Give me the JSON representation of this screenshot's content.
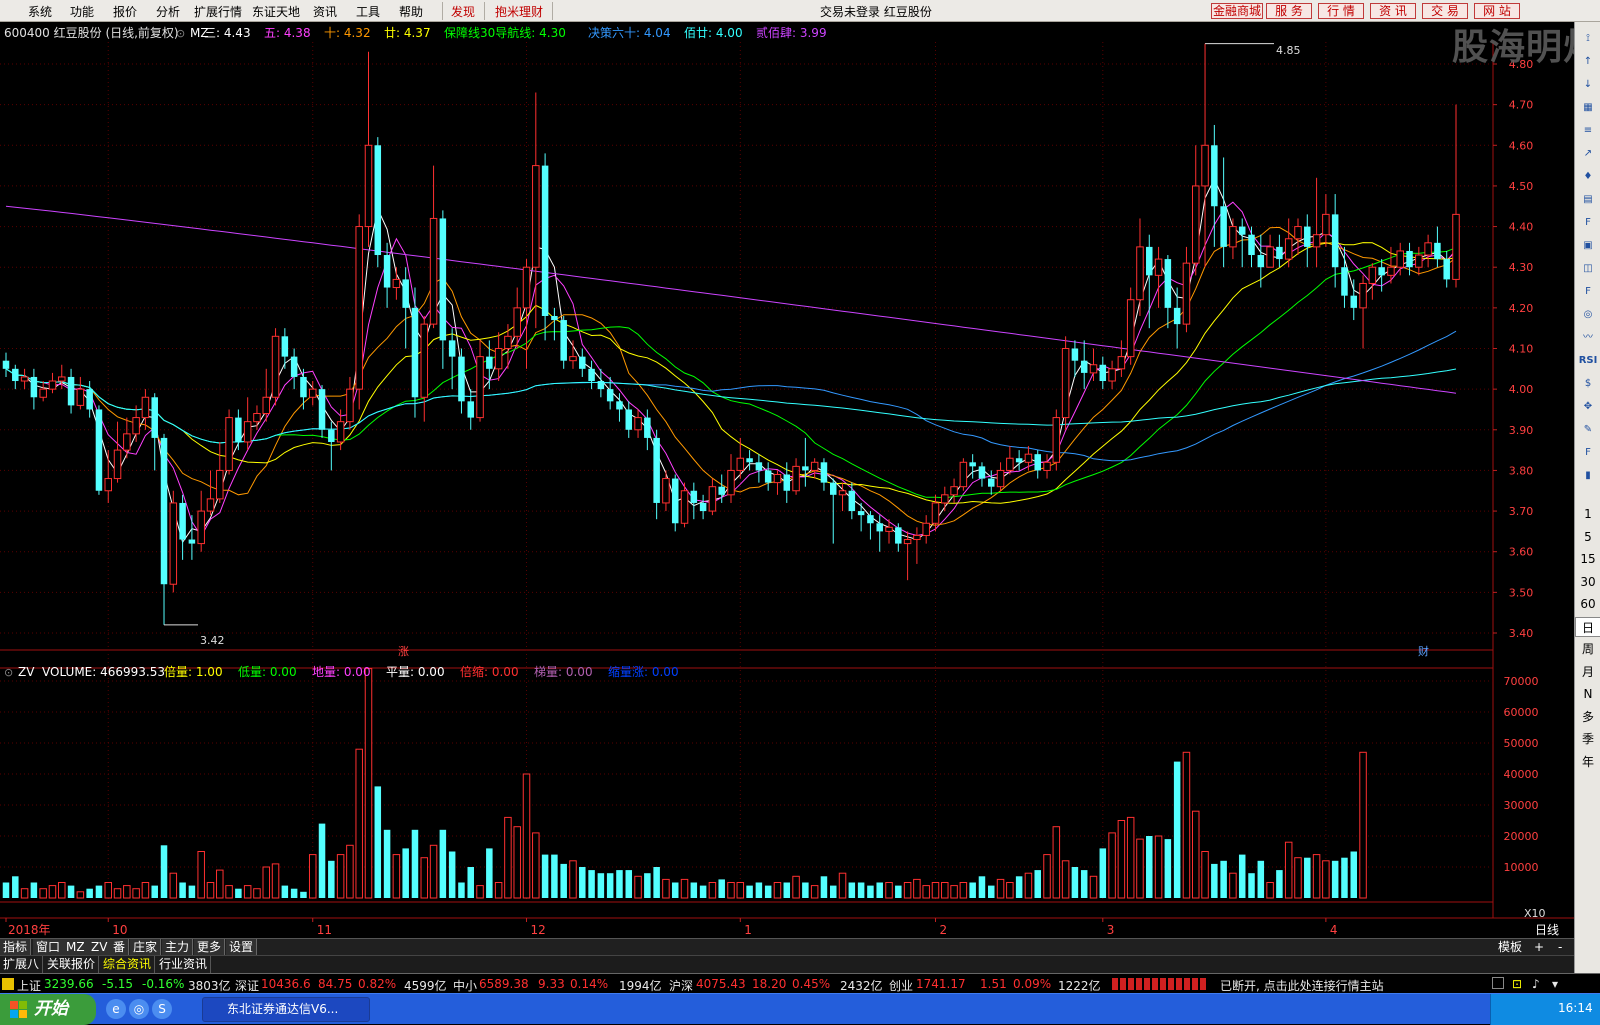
{
  "menu": {
    "items": [
      "系统",
      "功能",
      "报价",
      "分析",
      "扩展行情",
      "东证天地",
      "资讯",
      "工具",
      "帮助"
    ],
    "hot_items": [
      "发现",
      "抱米理财"
    ],
    "status": "交易未登录  红豆股份",
    "buttons": [
      "金融商城",
      "服  务",
      "行  情",
      "资  讯",
      "交  易",
      "网  站"
    ]
  },
  "watermark": "股海明灯",
  "header": {
    "code_name": "600400 红豆股份 (日线,前复权)",
    "indicator": "MZ",
    "items": [
      {
        "label": "三:",
        "value": "4.43",
        "color": "#ffffff"
      },
      {
        "label": "五:",
        "value": "4.38",
        "color": "#ff40ff"
      },
      {
        "label": "十:",
        "value": "4.32",
        "color": "#ff9900"
      },
      {
        "label": "廿:",
        "value": "4.37",
        "color": "#ffff00"
      },
      {
        "label": "保障线30导航线:",
        "value": "4.30",
        "color": "#00ff00"
      },
      {
        "label": "决策六十:",
        "value": "4.04",
        "color": "#3399ff"
      },
      {
        "label": "佰廿:",
        "value": "4.00",
        "color": "#33ffff"
      },
      {
        "label": "贰佰肆:",
        "value": "3.99",
        "color": "#cc44ff"
      }
    ]
  },
  "price_axis": {
    "ticks": [
      "4.80",
      "4.70",
      "4.60",
      "4.50",
      "4.40",
      "4.30",
      "4.20",
      "4.10",
      "4.00",
      "3.90",
      "3.80",
      "3.70",
      "3.60",
      "3.50",
      "3.40"
    ]
  },
  "annotations": {
    "high": "4.85",
    "low": "3.42",
    "zhang": "涨",
    "cai": "财",
    "x10": "X10"
  },
  "volume_header": {
    "indicator": "ZV",
    "items": [
      {
        "label": "VOLUME:",
        "value": "466993.53",
        "color": "#ffffff"
      },
      {
        "label": "倍量:",
        "value": "1.00",
        "color": "#ffff00"
      },
      {
        "label": "低量:",
        "value": "0.00",
        "color": "#00ff00"
      },
      {
        "label": "地量:",
        "value": "0.00",
        "color": "#ff40ff"
      },
      {
        "label": "平量:",
        "value": "0.00",
        "color": "#ffffff"
      },
      {
        "label": "倍缩:",
        "value": "0.00",
        "color": "#ff3030"
      },
      {
        "label": "梯量:",
        "value": "0.00",
        "color": "#b060b0"
      },
      {
        "label": "缩量涨:",
        "value": "0.00",
        "color": "#0040ff"
      }
    ]
  },
  "volume_axis": {
    "ticks": [
      "70000",
      "60000",
      "50000",
      "40000",
      "30000",
      "20000",
      "10000"
    ]
  },
  "date_axis": [
    "2018年",
    "10",
    "11",
    "12",
    "1",
    "2",
    "3",
    "4"
  ],
  "date_label": "日线",
  "right_tools": {
    "icons": [
      "pin-icon",
      "up-arrow-icon",
      "down-arrow-icon",
      "grid-icon",
      "list-icon",
      "chart-icon",
      "kline-icon",
      "table-icon",
      "f10-icon",
      "report-icon",
      "news-icon",
      "f2-icon",
      "compass-icon",
      "sig-icon",
      "rsi-icon",
      "dollar-icon",
      "move-icon",
      "pen-icon",
      "f5-icon",
      "bars-icon"
    ],
    "rsi": "RSI",
    "periods": [
      "1",
      "5",
      "15",
      "30",
      "60",
      "日",
      "周",
      "月",
      "N",
      "多",
      "季",
      "年"
    ]
  },
  "tabs1": {
    "items": [
      "指标",
      "窗口",
      "MZ",
      "ZV",
      "番",
      "庄家",
      "主力",
      "更多",
      "设置"
    ],
    "right": [
      "模板",
      "+",
      "-"
    ]
  },
  "tabs2": {
    "items": [
      "扩展八",
      "关联报价",
      "综合资讯",
      "行业资讯"
    ],
    "active": "综合资讯"
  },
  "ticker": {
    "sh": {
      "name": "上证",
      "price": "3239.66",
      "chg": "-5.15",
      "pct": "-0.16%",
      "amt": "3803亿"
    },
    "sz": {
      "name": "深证",
      "price": "10436.6",
      "chg": "84.75",
      "pct": "0.82%",
      "amt": "4599亿"
    },
    "zx": {
      "name": "中小",
      "price": "6589.38",
      "chg": "9.33",
      "pct": "0.14%",
      "amt": "1994亿"
    },
    "hs": {
      "name": "沪深",
      "price": "4075.43",
      "chg": "18.20",
      "pct": "0.45%",
      "amt": "2432亿"
    },
    "cy": {
      "name": "创业",
      "price": "1741.17",
      "chg": "1.51",
      "pct": "0.09%",
      "amt": "1222亿"
    },
    "msg": "已断开, 点击此处连接行情主站"
  },
  "taskbar": {
    "start": "开始",
    "app": "东北证券通达信V6...",
    "clock": "16:14"
  },
  "chart_data": {
    "type": "candlestick",
    "y_range": [
      3.4,
      4.85
    ],
    "high_marker": 4.85,
    "low_marker": 3.42,
    "ohlc": [
      [
        4.07,
        4.05,
        4.03,
        4.09
      ],
      [
        4.05,
        4.02,
        4.0,
        4.06
      ],
      [
        4.02,
        4.03,
        4.0,
        4.05
      ],
      [
        4.03,
        3.98,
        3.95,
        4.05
      ],
      [
        3.98,
        4.0,
        3.97,
        4.02
      ],
      [
        4.0,
        4.02,
        3.99,
        4.04
      ],
      [
        4.02,
        4.03,
        4.0,
        4.06
      ],
      [
        4.03,
        3.96,
        3.94,
        4.05
      ],
      [
        3.96,
        4.0,
        3.95,
        4.03
      ],
      [
        4.0,
        3.95,
        3.93,
        4.02
      ],
      [
        3.95,
        3.75,
        3.74,
        3.96
      ],
      [
        3.75,
        3.78,
        3.72,
        3.85
      ],
      [
        3.78,
        3.85,
        3.77,
        3.92
      ],
      [
        3.85,
        3.89,
        3.83,
        3.93
      ],
      [
        3.89,
        3.93,
        3.87,
        3.96
      ],
      [
        3.93,
        3.98,
        3.9,
        4.0
      ],
      [
        3.98,
        3.88,
        3.8,
        3.99
      ],
      [
        3.88,
        3.52,
        3.42,
        3.89
      ],
      [
        3.52,
        3.72,
        3.5,
        3.75
      ],
      [
        3.72,
        3.63,
        3.58,
        3.74
      ],
      [
        3.63,
        3.62,
        3.58,
        3.69
      ],
      [
        3.62,
        3.7,
        3.6,
        3.75
      ],
      [
        3.7,
        3.73,
        3.69,
        3.8
      ],
      [
        3.73,
        3.8,
        3.72,
        3.87
      ],
      [
        3.8,
        3.93,
        3.79,
        3.95
      ],
      [
        3.93,
        3.87,
        3.85,
        3.95
      ],
      [
        3.87,
        3.92,
        3.85,
        3.98
      ],
      [
        3.92,
        3.94,
        3.9,
        3.96
      ],
      [
        3.94,
        3.98,
        3.92,
        4.05
      ],
      [
        3.98,
        4.13,
        3.96,
        4.15
      ],
      [
        4.13,
        4.08,
        4.05,
        4.15
      ],
      [
        4.08,
        4.03,
        4.0,
        4.1
      ],
      [
        4.03,
        3.98,
        3.95,
        4.05
      ],
      [
        3.98,
        4.0,
        3.96,
        4.02
      ],
      [
        4.0,
        3.9,
        3.88,
        4.01
      ],
      [
        3.9,
        3.87,
        3.8,
        3.92
      ],
      [
        3.87,
        3.92,
        3.85,
        3.95
      ],
      [
        3.92,
        4.0,
        3.9,
        4.03
      ],
      [
        4.0,
        4.4,
        3.95,
        4.43
      ],
      [
        4.4,
        4.6,
        4.35,
        4.83
      ],
      [
        4.6,
        4.33,
        4.3,
        4.62
      ],
      [
        4.33,
        4.25,
        4.2,
        4.36
      ],
      [
        4.25,
        4.27,
        4.22,
        4.3
      ],
      [
        4.27,
        4.2,
        4.1,
        4.3
      ],
      [
        4.2,
        3.98,
        3.93,
        4.25
      ],
      [
        3.98,
        4.16,
        3.92,
        4.18
      ],
      [
        4.16,
        4.42,
        4.15,
        4.55
      ],
      [
        4.42,
        4.12,
        4.05,
        4.44
      ],
      [
        4.12,
        4.08,
        4.0,
        4.15
      ],
      [
        4.08,
        3.97,
        3.94,
        4.1
      ],
      [
        3.97,
        3.93,
        3.9,
        4.0
      ],
      [
        3.93,
        4.08,
        3.92,
        4.12
      ],
      [
        4.08,
        4.05,
        4.0,
        4.12
      ],
      [
        4.05,
        4.1,
        4.02,
        4.14
      ],
      [
        4.1,
        4.13,
        4.05,
        4.16
      ],
      [
        4.13,
        4.2,
        4.1,
        4.25
      ],
      [
        4.2,
        4.3,
        4.05,
        4.32
      ],
      [
        4.3,
        4.55,
        4.15,
        4.73
      ],
      [
        4.55,
        4.18,
        4.12,
        4.58
      ],
      [
        4.18,
        4.17,
        4.12,
        4.2
      ],
      [
        4.17,
        4.07,
        4.05,
        4.18
      ],
      [
        4.07,
        4.08,
        4.05,
        4.12
      ],
      [
        4.08,
        4.05,
        4.03,
        4.1
      ],
      [
        4.05,
        4.02,
        4.0,
        4.07
      ],
      [
        4.02,
        4.0,
        3.98,
        4.05
      ],
      [
        4.0,
        3.97,
        3.95,
        4.03
      ],
      [
        3.97,
        3.95,
        3.92,
        3.99
      ],
      [
        3.95,
        3.9,
        3.88,
        3.97
      ],
      [
        3.9,
        3.93,
        3.88,
        3.95
      ],
      [
        3.93,
        3.88,
        3.85,
        3.95
      ],
      [
        3.88,
        3.72,
        3.68,
        3.9
      ],
      [
        3.72,
        3.78,
        3.7,
        3.8
      ],
      [
        3.78,
        3.67,
        3.65,
        3.79
      ],
      [
        3.67,
        3.75,
        3.66,
        3.77
      ],
      [
        3.75,
        3.72,
        3.68,
        3.77
      ],
      [
        3.72,
        3.7,
        3.68,
        3.74
      ],
      [
        3.7,
        3.76,
        3.69,
        3.78
      ],
      [
        3.76,
        3.74,
        3.72,
        3.79
      ],
      [
        3.74,
        3.8,
        3.72,
        3.84
      ],
      [
        3.8,
        3.83,
        3.78,
        3.88
      ],
      [
        3.83,
        3.82,
        3.8,
        3.85
      ],
      [
        3.82,
        3.8,
        3.77,
        3.84
      ],
      [
        3.8,
        3.77,
        3.75,
        3.82
      ],
      [
        3.77,
        3.79,
        3.74,
        3.8
      ],
      [
        3.79,
        3.75,
        3.72,
        3.82
      ],
      [
        3.75,
        3.81,
        3.74,
        3.83
      ],
      [
        3.81,
        3.8,
        3.76,
        3.88
      ],
      [
        3.8,
        3.82,
        3.78,
        3.83
      ],
      [
        3.82,
        3.77,
        3.75,
        3.83
      ],
      [
        3.77,
        3.74,
        3.62,
        3.78
      ],
      [
        3.74,
        3.75,
        3.7,
        3.77
      ],
      [
        3.75,
        3.7,
        3.68,
        3.77
      ],
      [
        3.7,
        3.69,
        3.65,
        3.72
      ],
      [
        3.69,
        3.67,
        3.63,
        3.7
      ],
      [
        3.67,
        3.65,
        3.6,
        3.69
      ],
      [
        3.65,
        3.66,
        3.62,
        3.68
      ],
      [
        3.66,
        3.62,
        3.6,
        3.67
      ],
      [
        3.62,
        3.63,
        3.53,
        3.65
      ],
      [
        3.63,
        3.64,
        3.57,
        3.66
      ],
      [
        3.64,
        3.67,
        3.62,
        3.69
      ],
      [
        3.67,
        3.72,
        3.65,
        3.74
      ],
      [
        3.72,
        3.74,
        3.7,
        3.76
      ],
      [
        3.74,
        3.76,
        3.72,
        3.78
      ],
      [
        3.76,
        3.82,
        3.75,
        3.83
      ],
      [
        3.82,
        3.81,
        3.78,
        3.84
      ],
      [
        3.81,
        3.78,
        3.76,
        3.82
      ],
      [
        3.78,
        3.76,
        3.74,
        3.8
      ],
      [
        3.76,
        3.8,
        3.75,
        3.82
      ],
      [
        3.8,
        3.83,
        3.79,
        3.86
      ],
      [
        3.83,
        3.82,
        3.8,
        3.85
      ],
      [
        3.82,
        3.84,
        3.8,
        3.86
      ],
      [
        3.84,
        3.8,
        3.78,
        3.85
      ],
      [
        3.8,
        3.82,
        3.78,
        3.84
      ],
      [
        3.82,
        3.93,
        3.8,
        3.95
      ],
      [
        3.93,
        4.1,
        3.9,
        4.13
      ],
      [
        4.1,
        4.07,
        4.03,
        4.12
      ],
      [
        4.07,
        4.04,
        4.0,
        4.12
      ],
      [
        4.04,
        4.06,
        4.02,
        4.1
      ],
      [
        4.06,
        4.02,
        4.0,
        4.08
      ],
      [
        4.02,
        4.05,
        4.0,
        4.07
      ],
      [
        4.05,
        4.08,
        4.03,
        4.12
      ],
      [
        4.08,
        4.22,
        4.06,
        4.25
      ],
      [
        4.22,
        4.35,
        4.18,
        4.42
      ],
      [
        4.35,
        4.28,
        4.15,
        4.38
      ],
      [
        4.28,
        4.32,
        4.2,
        4.35
      ],
      [
        4.32,
        4.2,
        4.15,
        4.33
      ],
      [
        4.2,
        4.16,
        4.1,
        4.25
      ],
      [
        4.16,
        4.31,
        4.14,
        4.35
      ],
      [
        4.31,
        4.5,
        4.28,
        4.6
      ],
      [
        4.5,
        4.6,
        4.3,
        4.85
      ],
      [
        4.6,
        4.45,
        4.35,
        4.65
      ],
      [
        4.45,
        4.35,
        4.3,
        4.57
      ],
      [
        4.35,
        4.4,
        4.32,
        4.42
      ],
      [
        4.4,
        4.38,
        4.3,
        4.42
      ],
      [
        4.38,
        4.33,
        4.3,
        4.4
      ],
      [
        4.33,
        4.3,
        4.25,
        4.38
      ],
      [
        4.3,
        4.35,
        4.3,
        4.38
      ],
      [
        4.35,
        4.32,
        4.3,
        4.38
      ],
      [
        4.32,
        4.37,
        4.3,
        4.42
      ],
      [
        4.37,
        4.4,
        4.33,
        4.42
      ],
      [
        4.4,
        4.35,
        4.3,
        4.43
      ],
      [
        4.35,
        4.38,
        4.3,
        4.52
      ],
      [
        4.38,
        4.43,
        4.35,
        4.48
      ],
      [
        4.43,
        4.3,
        4.25,
        4.48
      ],
      [
        4.3,
        4.23,
        4.2,
        4.35
      ],
      [
        4.23,
        4.2,
        4.17,
        4.27
      ],
      [
        4.2,
        4.26,
        4.1,
        4.28
      ],
      [
        4.26,
        4.3,
        4.22,
        4.31
      ],
      [
        4.3,
        4.28,
        4.24,
        4.32
      ],
      [
        4.28,
        4.3,
        4.26,
        4.35
      ],
      [
        4.3,
        4.34,
        4.28,
        4.36
      ],
      [
        4.34,
        4.3,
        4.28,
        4.36
      ],
      [
        4.3,
        4.33,
        4.28,
        4.35
      ],
      [
        4.33,
        4.36,
        4.3,
        4.38
      ],
      [
        4.36,
        4.32,
        4.3,
        4.4
      ],
      [
        4.32,
        4.27,
        4.25,
        4.34
      ],
      [
        4.27,
        4.43,
        4.25,
        4.7
      ]
    ],
    "volume": [
      5,
      7,
      3,
      5,
      3,
      4,
      5,
      4,
      2,
      3,
      4,
      5,
      3,
      4,
      3,
      5,
      4,
      17,
      8,
      5,
      4,
      15,
      5,
      9,
      4,
      3,
      4,
      3,
      10,
      11,
      4,
      3,
      2,
      14,
      24,
      12,
      14,
      17,
      48,
      74,
      36,
      22,
      14,
      16,
      22,
      13,
      17,
      22,
      15,
      5,
      10,
      4,
      16,
      5,
      26,
      23,
      40,
      21,
      14,
      14,
      11,
      12,
      10,
      9,
      8,
      8,
      9,
      9,
      7,
      8,
      10,
      6,
      5,
      6,
      5,
      4,
      5,
      6,
      5,
      5,
      4,
      5,
      4,
      5,
      5,
      7,
      5,
      4,
      7,
      4,
      8,
      5,
      5,
      4,
      5,
      5,
      4,
      5,
      6,
      4,
      5,
      5,
      4,
      5,
      5,
      7,
      4,
      6,
      5,
      7,
      8,
      9,
      14,
      23,
      12,
      10,
      9,
      7,
      16,
      21,
      25,
      26,
      19,
      20,
      20,
      19,
      44,
      47,
      28,
      15,
      11,
      12,
      8,
      14,
      8,
      12,
      5,
      9,
      18,
      13,
      13,
      14,
      12,
      12,
      13,
      15,
      47
    ]
  }
}
